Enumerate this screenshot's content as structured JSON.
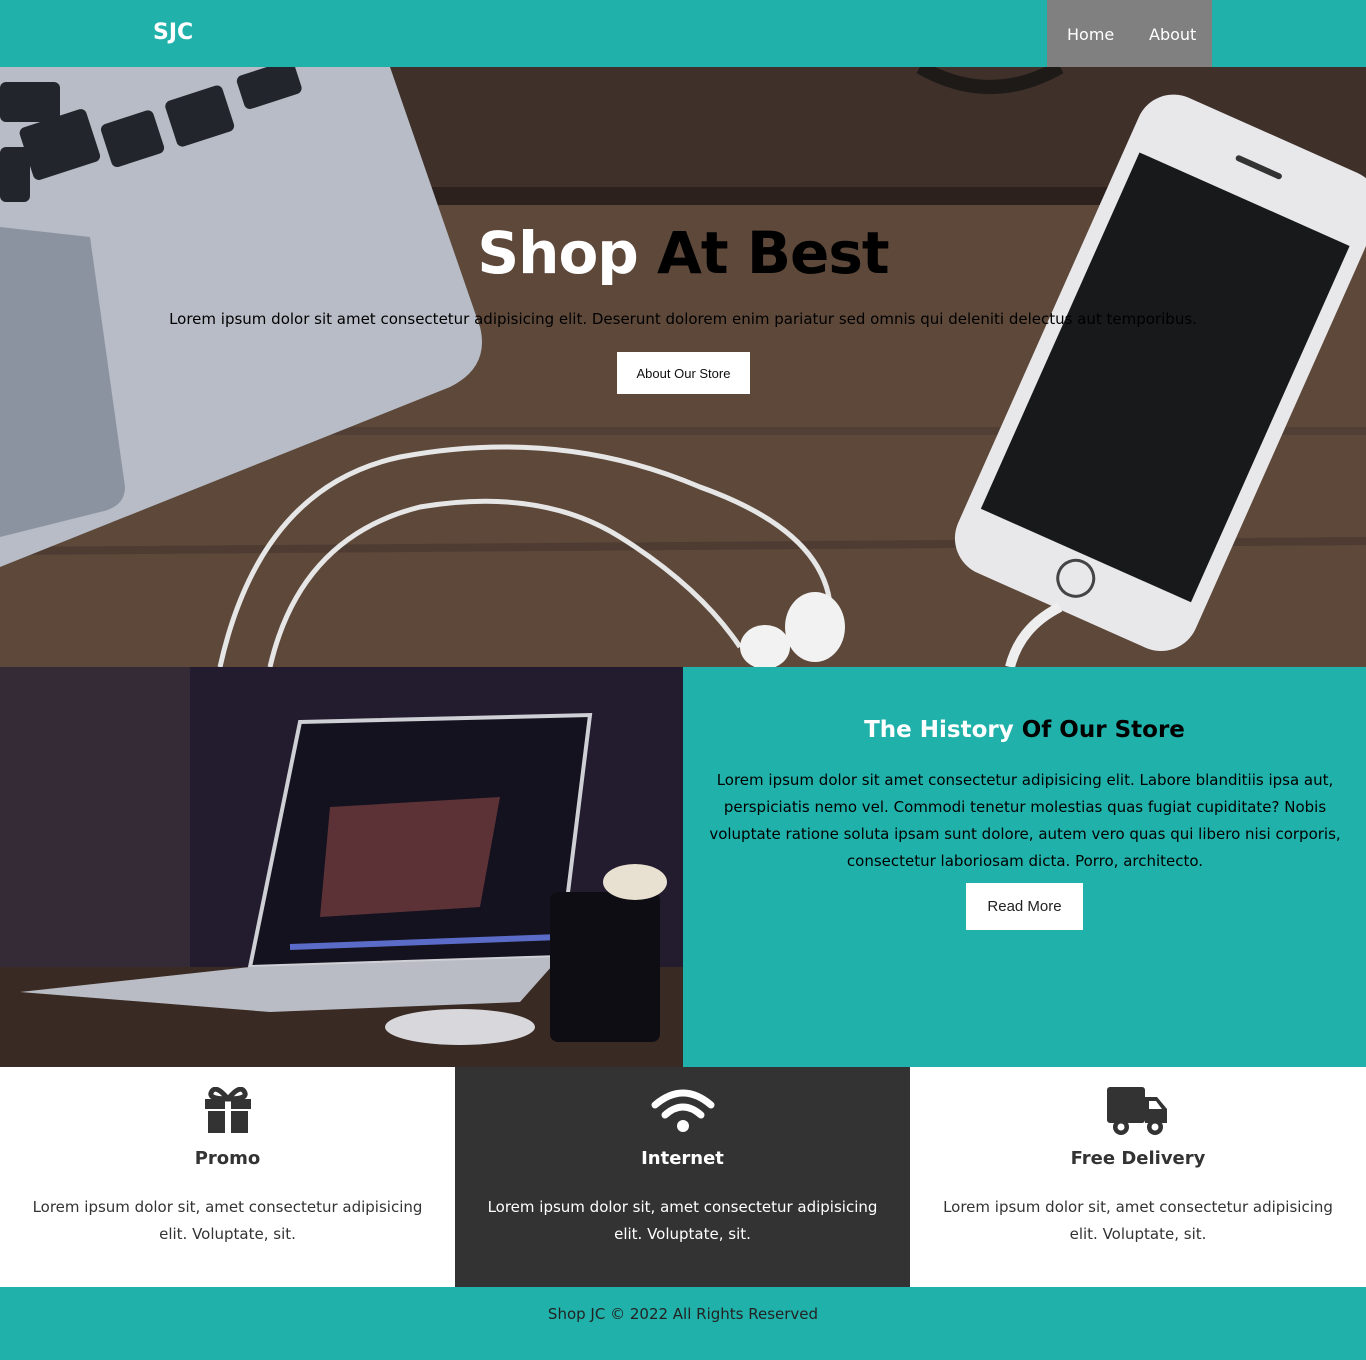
{
  "nav": {
    "logo": "SJC",
    "links": [
      {
        "label": "Home"
      },
      {
        "label": "About"
      }
    ]
  },
  "hero": {
    "title_part1": "Shop",
    "title_part2": "At Best",
    "text": "Lorem ipsum dolor sit amet consectetur adipisicing elit. Deserunt dolorem enim pariatur sed omnis qui deleniti delectus aut temporibus.",
    "button": "About Our Store"
  },
  "history": {
    "title_part1": "The History",
    "title_part2": "Of Our Store",
    "text": "Lorem ipsum dolor sit amet consectetur adipisicing elit. Labore blanditiis ipsa aut, perspiciatis nemo vel. Commodi tenetur molestias quas fugiat cupiditate? Nobis voluptate ratione soluta ipsam sunt dolore, autem vero quas qui libero nisi corporis, consectetur laboriosam dicta. Porro, architecto.",
    "button": "Read More"
  },
  "features": [
    {
      "icon": "gift-icon",
      "title": "Promo",
      "text": "Lorem ipsum dolor sit, amet consectetur adipisicing elit. Voluptate, sit."
    },
    {
      "icon": "wifi-icon",
      "title": "Internet",
      "text": "Lorem ipsum dolor sit, amet consectetur adipisicing elit. Voluptate, sit."
    },
    {
      "icon": "truck-icon",
      "title": "Free Delivery",
      "text": "Lorem ipsum dolor sit, amet consectetur adipisicing elit. Voluptate, sit."
    }
  ],
  "footer": {
    "text": "Shop JC © 2022 All Rights Reserved"
  },
  "colors": {
    "accent": "#20b2aa",
    "nav_menu_bg": "#808080",
    "dark_panel": "#333333"
  }
}
